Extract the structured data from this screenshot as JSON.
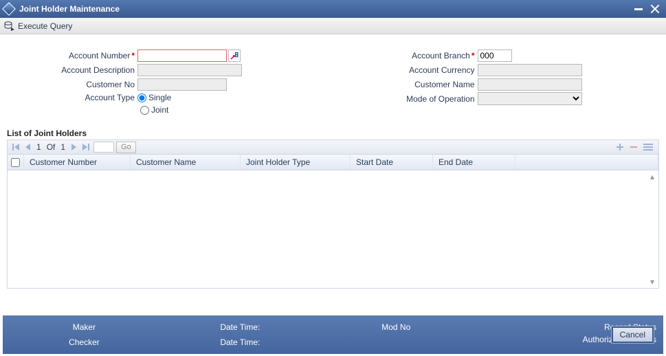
{
  "title": "Joint Holder Maintenance",
  "toolbar": {
    "execute_label": "Execute Query"
  },
  "form": {
    "left": {
      "account_number": {
        "label": "Account Number",
        "value": ""
      },
      "account_description": {
        "label": "Account Description",
        "value": ""
      },
      "customer_no": {
        "label": "Customer No",
        "value": ""
      },
      "account_type": {
        "label": "Account Type",
        "options": {
          "single": "Single",
          "joint": "Joint"
        },
        "selected": "single"
      }
    },
    "right": {
      "account_branch": {
        "label": "Account Branch",
        "value": "000"
      },
      "account_currency": {
        "label": "Account Currency",
        "value": ""
      },
      "customer_name": {
        "label": "Customer Name",
        "value": ""
      },
      "mode_of_operation": {
        "label": "Mode of Operation",
        "value": ""
      }
    }
  },
  "list": {
    "title": "List of Joint Holders",
    "pager": {
      "page": "1",
      "of_label": "Of",
      "total": "1",
      "go_label": "Go"
    },
    "columns": {
      "customer_number": "Customer Number",
      "customer_name": "Customer Name",
      "joint_holder_type": "Joint Holder Type",
      "start_date": "Start Date",
      "end_date": "End Date"
    }
  },
  "status": {
    "maker": "Maker",
    "checker": "Checker",
    "datetime1": "Date Time:",
    "datetime2": "Date Time:",
    "modno": "Mod No",
    "record_status": "Record Status",
    "auth_status": "Authorization Status"
  },
  "buttons": {
    "cancel": "Cancel"
  }
}
